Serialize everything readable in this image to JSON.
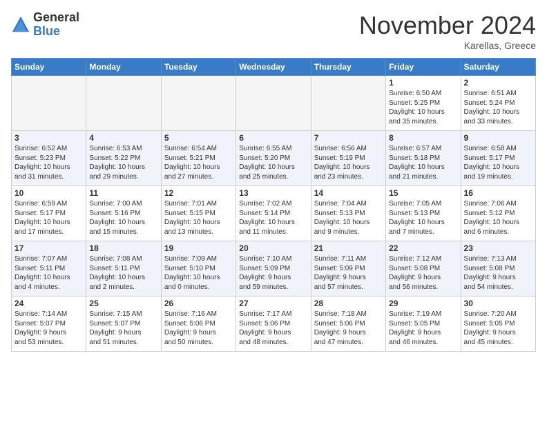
{
  "logo": {
    "general": "General",
    "blue": "Blue"
  },
  "title": "November 2024",
  "location": "Karellas, Greece",
  "days": [
    "Sunday",
    "Monday",
    "Tuesday",
    "Wednesday",
    "Thursday",
    "Friday",
    "Saturday"
  ],
  "weeks": [
    [
      {
        "day": "",
        "info": ""
      },
      {
        "day": "",
        "info": ""
      },
      {
        "day": "",
        "info": ""
      },
      {
        "day": "",
        "info": ""
      },
      {
        "day": "",
        "info": ""
      },
      {
        "day": "1",
        "info": "Sunrise: 6:50 AM\nSunset: 5:25 PM\nDaylight: 10 hours\nand 35 minutes."
      },
      {
        "day": "2",
        "info": "Sunrise: 6:51 AM\nSunset: 5:24 PM\nDaylight: 10 hours\nand 33 minutes."
      }
    ],
    [
      {
        "day": "3",
        "info": "Sunrise: 6:52 AM\nSunset: 5:23 PM\nDaylight: 10 hours\nand 31 minutes."
      },
      {
        "day": "4",
        "info": "Sunrise: 6:53 AM\nSunset: 5:22 PM\nDaylight: 10 hours\nand 29 minutes."
      },
      {
        "day": "5",
        "info": "Sunrise: 6:54 AM\nSunset: 5:21 PM\nDaylight: 10 hours\nand 27 minutes."
      },
      {
        "day": "6",
        "info": "Sunrise: 6:55 AM\nSunset: 5:20 PM\nDaylight: 10 hours\nand 25 minutes."
      },
      {
        "day": "7",
        "info": "Sunrise: 6:56 AM\nSunset: 5:19 PM\nDaylight: 10 hours\nand 23 minutes."
      },
      {
        "day": "8",
        "info": "Sunrise: 6:57 AM\nSunset: 5:18 PM\nDaylight: 10 hours\nand 21 minutes."
      },
      {
        "day": "9",
        "info": "Sunrise: 6:58 AM\nSunset: 5:17 PM\nDaylight: 10 hours\nand 19 minutes."
      }
    ],
    [
      {
        "day": "10",
        "info": "Sunrise: 6:59 AM\nSunset: 5:17 PM\nDaylight: 10 hours\nand 17 minutes."
      },
      {
        "day": "11",
        "info": "Sunrise: 7:00 AM\nSunset: 5:16 PM\nDaylight: 10 hours\nand 15 minutes."
      },
      {
        "day": "12",
        "info": "Sunrise: 7:01 AM\nSunset: 5:15 PM\nDaylight: 10 hours\nand 13 minutes."
      },
      {
        "day": "13",
        "info": "Sunrise: 7:02 AM\nSunset: 5:14 PM\nDaylight: 10 hours\nand 11 minutes."
      },
      {
        "day": "14",
        "info": "Sunrise: 7:04 AM\nSunset: 5:13 PM\nDaylight: 10 hours\nand 9 minutes."
      },
      {
        "day": "15",
        "info": "Sunrise: 7:05 AM\nSunset: 5:13 PM\nDaylight: 10 hours\nand 7 minutes."
      },
      {
        "day": "16",
        "info": "Sunrise: 7:06 AM\nSunset: 5:12 PM\nDaylight: 10 hours\nand 6 minutes."
      }
    ],
    [
      {
        "day": "17",
        "info": "Sunrise: 7:07 AM\nSunset: 5:11 PM\nDaylight: 10 hours\nand 4 minutes."
      },
      {
        "day": "18",
        "info": "Sunrise: 7:08 AM\nSunset: 5:11 PM\nDaylight: 10 hours\nand 2 minutes."
      },
      {
        "day": "19",
        "info": "Sunrise: 7:09 AM\nSunset: 5:10 PM\nDaylight: 10 hours\nand 0 minutes."
      },
      {
        "day": "20",
        "info": "Sunrise: 7:10 AM\nSunset: 5:09 PM\nDaylight: 9 hours\nand 59 minutes."
      },
      {
        "day": "21",
        "info": "Sunrise: 7:11 AM\nSunset: 5:09 PM\nDaylight: 9 hours\nand 57 minutes."
      },
      {
        "day": "22",
        "info": "Sunrise: 7:12 AM\nSunset: 5:08 PM\nDaylight: 9 hours\nand 56 minutes."
      },
      {
        "day": "23",
        "info": "Sunrise: 7:13 AM\nSunset: 5:08 PM\nDaylight: 9 hours\nand 54 minutes."
      }
    ],
    [
      {
        "day": "24",
        "info": "Sunrise: 7:14 AM\nSunset: 5:07 PM\nDaylight: 9 hours\nand 53 minutes."
      },
      {
        "day": "25",
        "info": "Sunrise: 7:15 AM\nSunset: 5:07 PM\nDaylight: 9 hours\nand 51 minutes."
      },
      {
        "day": "26",
        "info": "Sunrise: 7:16 AM\nSunset: 5:06 PM\nDaylight: 9 hours\nand 50 minutes."
      },
      {
        "day": "27",
        "info": "Sunrise: 7:17 AM\nSunset: 5:06 PM\nDaylight: 9 hours\nand 48 minutes."
      },
      {
        "day": "28",
        "info": "Sunrise: 7:18 AM\nSunset: 5:06 PM\nDaylight: 9 hours\nand 47 minutes."
      },
      {
        "day": "29",
        "info": "Sunrise: 7:19 AM\nSunset: 5:05 PM\nDaylight: 9 hours\nand 46 minutes."
      },
      {
        "day": "30",
        "info": "Sunrise: 7:20 AM\nSunset: 5:05 PM\nDaylight: 9 hours\nand 45 minutes."
      }
    ]
  ]
}
